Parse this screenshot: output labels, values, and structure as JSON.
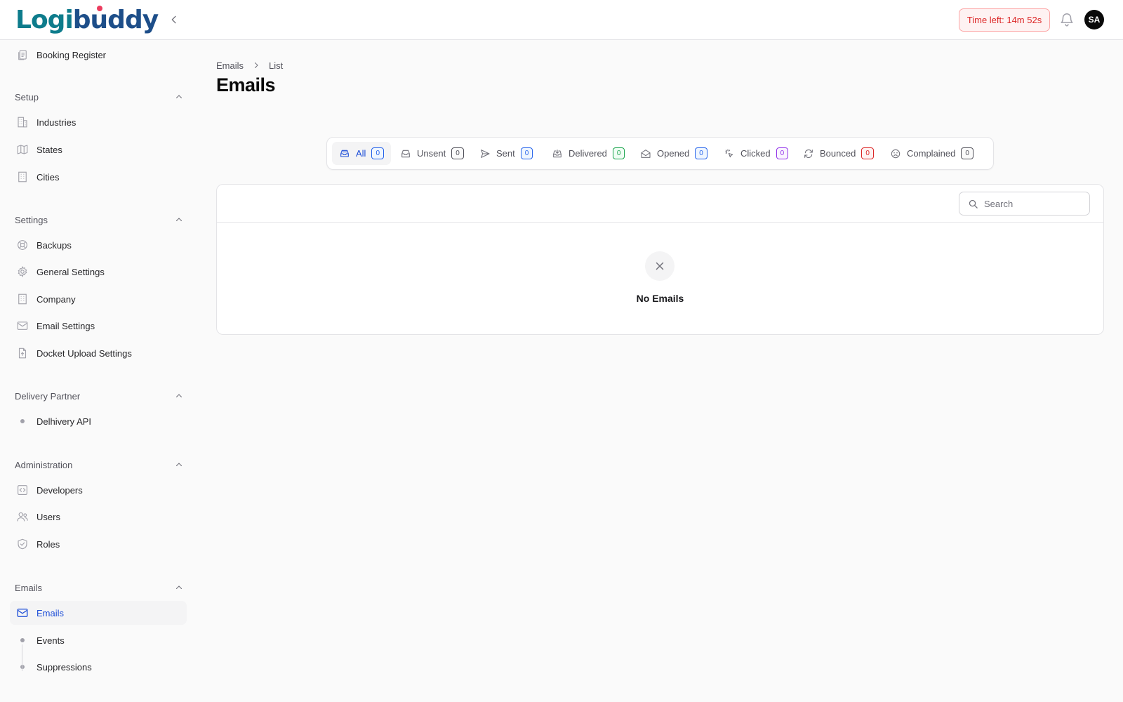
{
  "app": {
    "logo_text_a": "Logi",
    "logo_text_b": "buddy",
    "timer": "Time left: 14m 52s",
    "avatar_initials": "SA"
  },
  "sidebar": {
    "top_item": "Booking Register",
    "groups": [
      {
        "label": "Setup",
        "items": [
          "Industries",
          "States",
          "Cities"
        ]
      },
      {
        "label": "Settings",
        "items": [
          "Backups",
          "General Settings",
          "Company",
          "Email Settings",
          "Docket Upload Settings"
        ]
      },
      {
        "label": "Delivery Partner",
        "items": [
          "Delhivery API"
        ]
      },
      {
        "label": "Administration",
        "items": [
          "Developers",
          "Users",
          "Roles"
        ]
      },
      {
        "label": "Emails",
        "items": [
          "Emails",
          "Events",
          "Suppressions"
        ]
      }
    ],
    "active_item": "Emails"
  },
  "breadcrumb": {
    "root": "Emails",
    "current": "List"
  },
  "page_title": "Emails",
  "tabs": [
    {
      "label": "All",
      "count": "0",
      "icon": "inbox-stack-icon",
      "active": true
    },
    {
      "label": "Unsent",
      "count": "0",
      "icon": "inbox-icon"
    },
    {
      "label": "Sent",
      "count": "0",
      "icon": "paper-airplane-icon"
    },
    {
      "label": "Delivered",
      "count": "0",
      "icon": "inbox-arrow-down-icon"
    },
    {
      "label": "Opened",
      "count": "0",
      "icon": "envelope-open-icon"
    },
    {
      "label": "Clicked",
      "count": "0",
      "icon": "cursor-click-icon"
    },
    {
      "label": "Bounced",
      "count": "0",
      "icon": "arrow-path-icon"
    },
    {
      "label": "Complained",
      "count": "0",
      "icon": "face-frown-icon"
    }
  ],
  "table": {
    "search_placeholder": "Search",
    "empty_text": "No Emails"
  },
  "colors": {
    "accent": "#1d4ed8",
    "timer_text": "#dc2626",
    "logo_teal": "#0e7c8c",
    "logo_navy": "#1d4e89"
  }
}
